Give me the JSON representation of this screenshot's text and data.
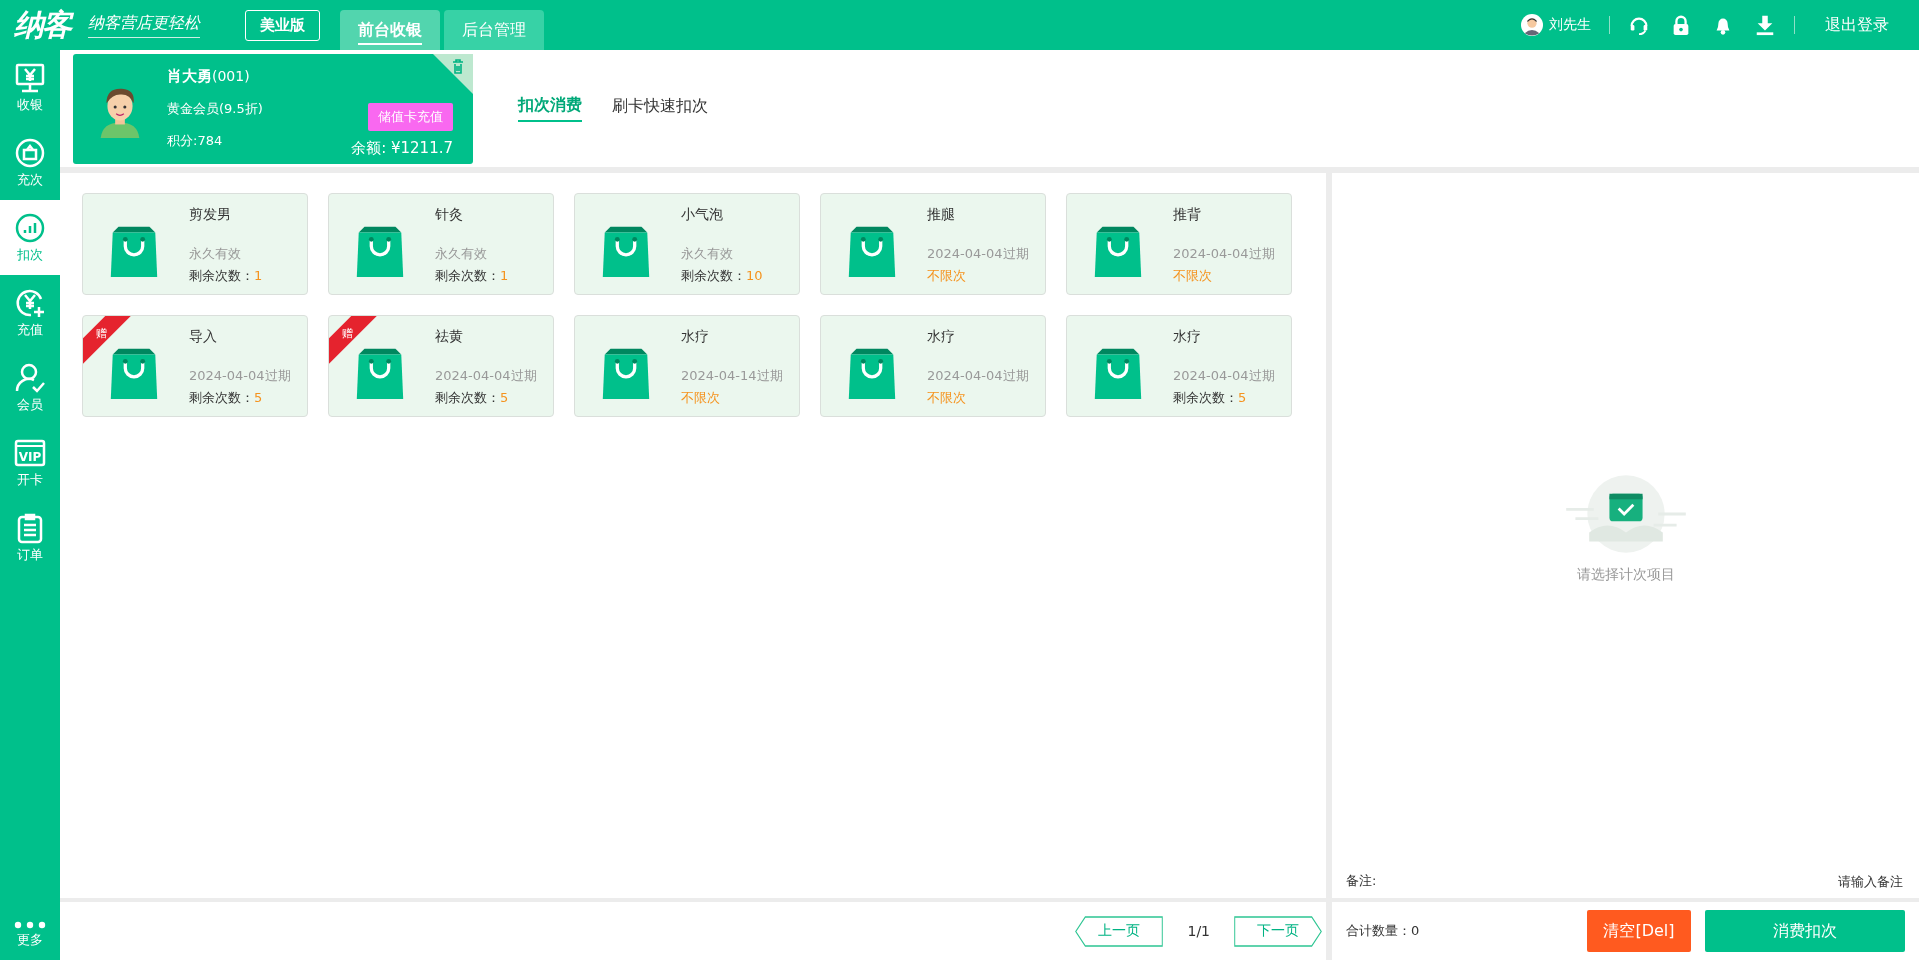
{
  "header": {
    "logo": "纳客",
    "slogan": "纳客营店更轻松",
    "edition": "美业版",
    "nav_tabs": [
      {
        "label": "前台收银",
        "selected": true
      },
      {
        "label": "后台管理",
        "selected": false
      }
    ],
    "user": "刘先生",
    "logout": "退出登录"
  },
  "sidebar": {
    "items": [
      {
        "label": "收银",
        "kind": "cashier",
        "selected": false
      },
      {
        "label": "充次",
        "kind": "recharge-count",
        "selected": false
      },
      {
        "label": "扣次",
        "kind": "deduct",
        "selected": true
      },
      {
        "label": "充值",
        "kind": "topup",
        "selected": false
      },
      {
        "label": "会员",
        "kind": "member",
        "selected": false
      },
      {
        "label": "开卡",
        "kind": "vip",
        "icon_text": "VIP",
        "selected": false
      },
      {
        "label": "订单",
        "kind": "order",
        "selected": false
      }
    ],
    "more": "更多"
  },
  "member": {
    "name": "肖大勇",
    "code": "(001)",
    "level": "黄金会员(9.5折)",
    "points": "积分:784",
    "recharge_button": "储值卡充值",
    "balance": "余额: ¥1211.7"
  },
  "sub_tabs": [
    {
      "label": "扣次消费",
      "selected": true
    },
    {
      "label": "刷卡快速扣次",
      "selected": false
    }
  ],
  "items": [
    {
      "name": "剪发男",
      "validity": "永久有效",
      "kind": "count",
      "remain_label": "剩余次数：",
      "remain_value": "1"
    },
    {
      "name": "针灸",
      "validity": "永久有效",
      "kind": "count",
      "remain_label": "剩余次数：",
      "remain_value": "1"
    },
    {
      "name": "小气泡",
      "validity": "永久有效",
      "kind": "count",
      "remain_label": "剩余次数：",
      "remain_value": "10"
    },
    {
      "name": "推腿",
      "validity": "2024-04-04过期",
      "kind": "unlimited",
      "remain_value": "不限次"
    },
    {
      "name": "推背",
      "validity": "2024-04-04过期",
      "kind": "unlimited",
      "remain_value": "不限次"
    },
    {
      "name": "导入",
      "badge": "赠",
      "validity": "2024-04-04过期",
      "kind": "count",
      "remain_label": "剩余次数：",
      "remain_value": "5"
    },
    {
      "name": "祛黄",
      "badge": "赠",
      "validity": "2024-04-04过期",
      "kind": "count",
      "remain_label": "剩余次数：",
      "remain_value": "5"
    },
    {
      "name": "水疗",
      "validity": "2024-04-14过期",
      "kind": "unlimited",
      "remain_value": "不限次"
    },
    {
      "name": "水疗",
      "validity": "2024-04-04过期",
      "kind": "unlimited",
      "remain_value": "不限次"
    },
    {
      "name": "水疗",
      "validity": "2024-04-04过期",
      "kind": "count",
      "remain_label": "剩余次数：",
      "remain_value": "5"
    }
  ],
  "pager": {
    "prev": "上一页",
    "page": "1/1",
    "next": "下一页"
  },
  "cart": {
    "empty_text": "请选择计次项目",
    "remark_label": "备注:",
    "remark_placeholder": "请输入备注",
    "total": "合计数量：0",
    "clear_button": "清空[Del]",
    "submit_button": "消费扣次"
  }
}
